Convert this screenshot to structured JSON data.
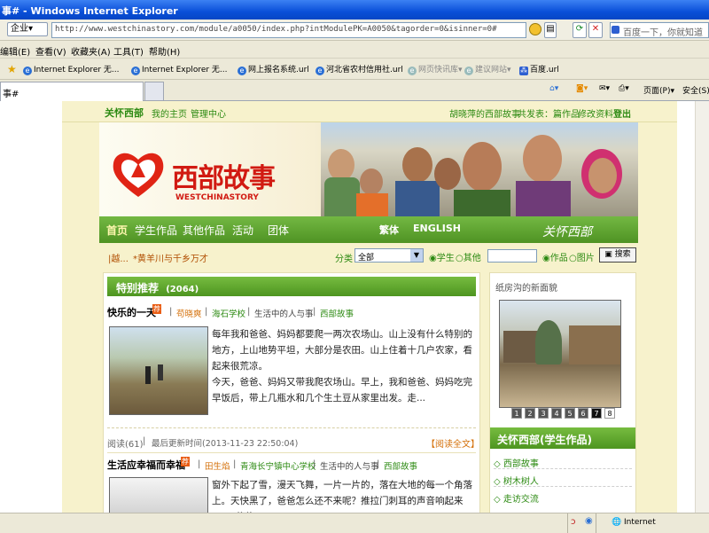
{
  "browser": {
    "title": "事# - Windows Internet Explorer",
    "address_prefix": "企业",
    "url": "http://www.westchinastory.com/module/a0050/index.php?intModulePK=A0050&tagorder=0&isinner=0#",
    "search_placeholder": "百度一下，你就知道",
    "menu": [
      "编辑(E)",
      "查看(V)",
      "收藏夹(A)",
      "工具(T)",
      "帮助(H)"
    ],
    "favorites": [
      "Internet Explorer 无...",
      "Internet Explorer 无...",
      "网上报名系统.url",
      "河北省农村信用社.url",
      "网页快讯库",
      "建议网站",
      "百度.url"
    ],
    "tab_title": "事#",
    "tools": [
      "页面(P)",
      "安全(S)"
    ],
    "status_zone": "Internet"
  },
  "site": {
    "topbar": {
      "brand": "关怀西部",
      "links": [
        "我的主页",
        "管理中心"
      ],
      "right_text": "胡晓萍的西部故事",
      "stats": "共发表：篇作品",
      "edit": "修改资料",
      "logout": "登出"
    },
    "banner": {
      "logo_cn": "西部故事",
      "logo_en": "WESTCHINASTORY"
    },
    "nav": [
      "首页",
      "学生作品",
      "其他作品",
      "活动",
      "团体"
    ],
    "nav_right": [
      "繁体",
      "ENGLISH"
    ],
    "nav_slogan": "关怀西部",
    "marquee": [
      "|越...",
      "*黄羊川与千乡万才"
    ],
    "filter": {
      "category_label": "分类",
      "category_value": "全部",
      "radio1": "学生",
      "radio2": "其他",
      "radio3": "作品",
      "radio4": "图片",
      "search_button": "搜索"
    },
    "featured": {
      "header": "特别推荐",
      "count": "(2064)",
      "articles": [
        {
          "title": "快乐的一天",
          "badge": "荐",
          "author": "苟晓爽",
          "school": "海石学校",
          "category": "生活中的人与事",
          "column": "西部故事",
          "text1": "每年我和爸爸、妈妈都要爬一两次农场山。山上没有什么特别的地方，上山地势平坦，大部分是农田。山上住着十几户农家，看起来很荒凉。",
          "text2": "今天，爸爸、妈妈又带我爬农场山。早上，我和爸爸、妈妈吃完早饭后，带上几瓶水和几个生土豆从家里出发。走...",
          "reads": "阅读(61)",
          "updated": "最后更新时间(2013-11-23 22:50:04)",
          "readmore": "【阅读全文】"
        },
        {
          "title": "生活应幸福而幸福",
          "badge": "荐",
          "author": "田生焰",
          "school": "青海长宁镇中心学校",
          "category": "生活中的人与事",
          "column": "西部故事",
          "text1": "窗外下起了雪，漫天飞舞，一片一片的，落在大地的每一个角落上。天快黑了，爸爸怎么还不来呢？推拉门刺耳的声音响起来了，“爸爸"
        }
      ]
    },
    "sidebar": {
      "photo_caption": "纸房沟的新面貌",
      "pages": [
        "1",
        "2",
        "3",
        "4",
        "5",
        "6",
        "7",
        "8"
      ],
      "section_title": "关怀西部(学生作品)",
      "items": [
        "西部故事",
        "树木树人",
        "走访交流"
      ]
    }
  }
}
